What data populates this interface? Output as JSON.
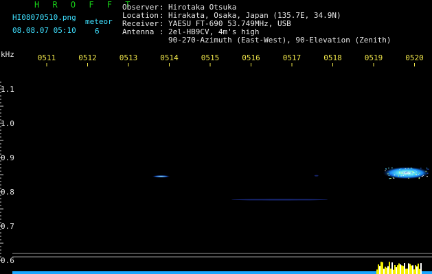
{
  "header": {
    "app_title": "H R O F F T",
    "filename": "HI08070510.png",
    "datetime": "08.08.07 05:10",
    "meteor_label": "meteor",
    "meteor_count": "6",
    "observer_label": "Observer",
    "observer_value": "Hirotaka Otsuka",
    "location_label": "Location",
    "location_value": "Hirakata, Osaka, Japan (135.7E, 34.9N)",
    "receiver_label": "Receiver",
    "receiver_value": "YAESU FT-690 53.749MHz, USB",
    "antenna_label": "Antenna",
    "antenna_value": "2el-HB9CV, 4m's high",
    "antenna_value2": "90-270-Azimuth (East-West), 90-Elevation (Zenith)"
  },
  "colors": {
    "background": "#000000",
    "title": "#19d219",
    "cyan_text": "#3fe0ff",
    "tick_labels": "#f0e64a",
    "axis_text": "#e8e8e8"
  },
  "chart_data": {
    "type": "heatmap",
    "title": "",
    "xlabel": "",
    "ylabel": "kHz",
    "x_ticks": [
      "0511",
      "0512",
      "0513",
      "0514",
      "0515",
      "0516",
      "0517",
      "0518",
      "0519",
      "0520"
    ],
    "y_ticks": [
      "1.1",
      "1.0",
      "0.9",
      "0.8",
      "0.7",
      "0.6"
    ],
    "ylim": [
      0.6,
      1.1
    ],
    "reference_lines_khz": [
      0.62,
      0.61
    ],
    "echoes": [
      {
        "label": "meteor",
        "time_min": 13.8,
        "freq_khz": 0.845,
        "strength": "weak"
      },
      {
        "label": "meteor",
        "time_min": 17.6,
        "freq_khz": 0.847,
        "strength": "very weak"
      },
      {
        "label": "meteor",
        "time_min": 16.7,
        "freq_khz": 0.777,
        "strength": "very weak"
      },
      {
        "label": "meteor",
        "time_min": 19.8,
        "freq_khz": 0.855,
        "strength": "strong"
      }
    ],
    "grid": false
  }
}
